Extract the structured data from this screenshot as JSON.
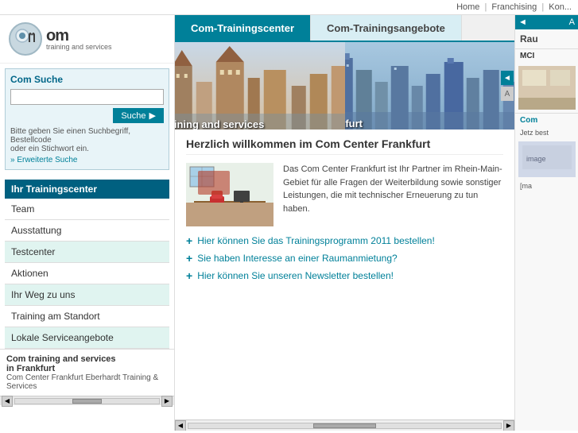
{
  "topnav": {
    "home": "Home",
    "sep1": "|",
    "franchising": "Franchising",
    "sep2": "|",
    "kontakt": "Kon..."
  },
  "logo": {
    "brand": "om",
    "tagline": "training and services"
  },
  "search": {
    "title": "Com Suche",
    "placeholder": "",
    "button_label": "Suche",
    "hint": "Bitte geben Sie einen Suchbegriff, Bestellcode\noder ein Stichwort ein.",
    "hint_line1": "Bitte geben Sie einen Suchbegriff, Bestellcode",
    "hint_line2": "oder ein Stichwort ein.",
    "erweiterte": "» Erweiterte Suche"
  },
  "sidebar": {
    "section_title": "Ihr Trainingscenter",
    "items": [
      {
        "label": "Team"
      },
      {
        "label": "Ausstattung"
      },
      {
        "label": "Testcenter"
      },
      {
        "label": "Aktionen"
      },
      {
        "label": "Ihr Weg zu uns"
      },
      {
        "label": "Training am Standort"
      },
      {
        "label": "Lokale Serviceangebote"
      }
    ],
    "bottom_title": "Com training and services\nin Frankfurt",
    "bottom_title_line1": "Com training and services",
    "bottom_title_line2": "in Frankfurt",
    "bottom_text": "Com Center Frankfurt Eberhardt Training &\nServices",
    "bottom_text_line1": "Com Center Frankfurt Eberhardt Training &",
    "bottom_text_line2": "Services"
  },
  "tabs": [
    {
      "label": "Com-Trainingscenter",
      "active": true
    },
    {
      "label": "Com-Trainingsangebote",
      "active": false
    }
  ],
  "hero": {
    "left_text": "Com training and services",
    "right_text": "in Frankfurt"
  },
  "welcome": {
    "heading": "Herzlich willkommen im Com Center Frankfurt",
    "body": "Das Com Center Frankfurt ist Ihr Partner im Rhein-Main-Gebiet für alle Fragen der Weiterbildung sowie sonstiger Leistungen, die mit technischer Erneuerung zu tun haben."
  },
  "links": [
    {
      "text": "Hier können Sie das Trainingsprogramm 2011 bestellen!"
    },
    {
      "text": "Sie haben Interesse an einer Raumanmietung?"
    },
    {
      "text": "Hier können Sie unseren Newsletter bestellen!"
    }
  ],
  "right_panel": {
    "arrow_label": "A",
    "title": "Rau",
    "subtitle": "MCI",
    "com_label": "Com",
    "jetzt_text": "Jetz best",
    "mail_label": "[ma"
  }
}
